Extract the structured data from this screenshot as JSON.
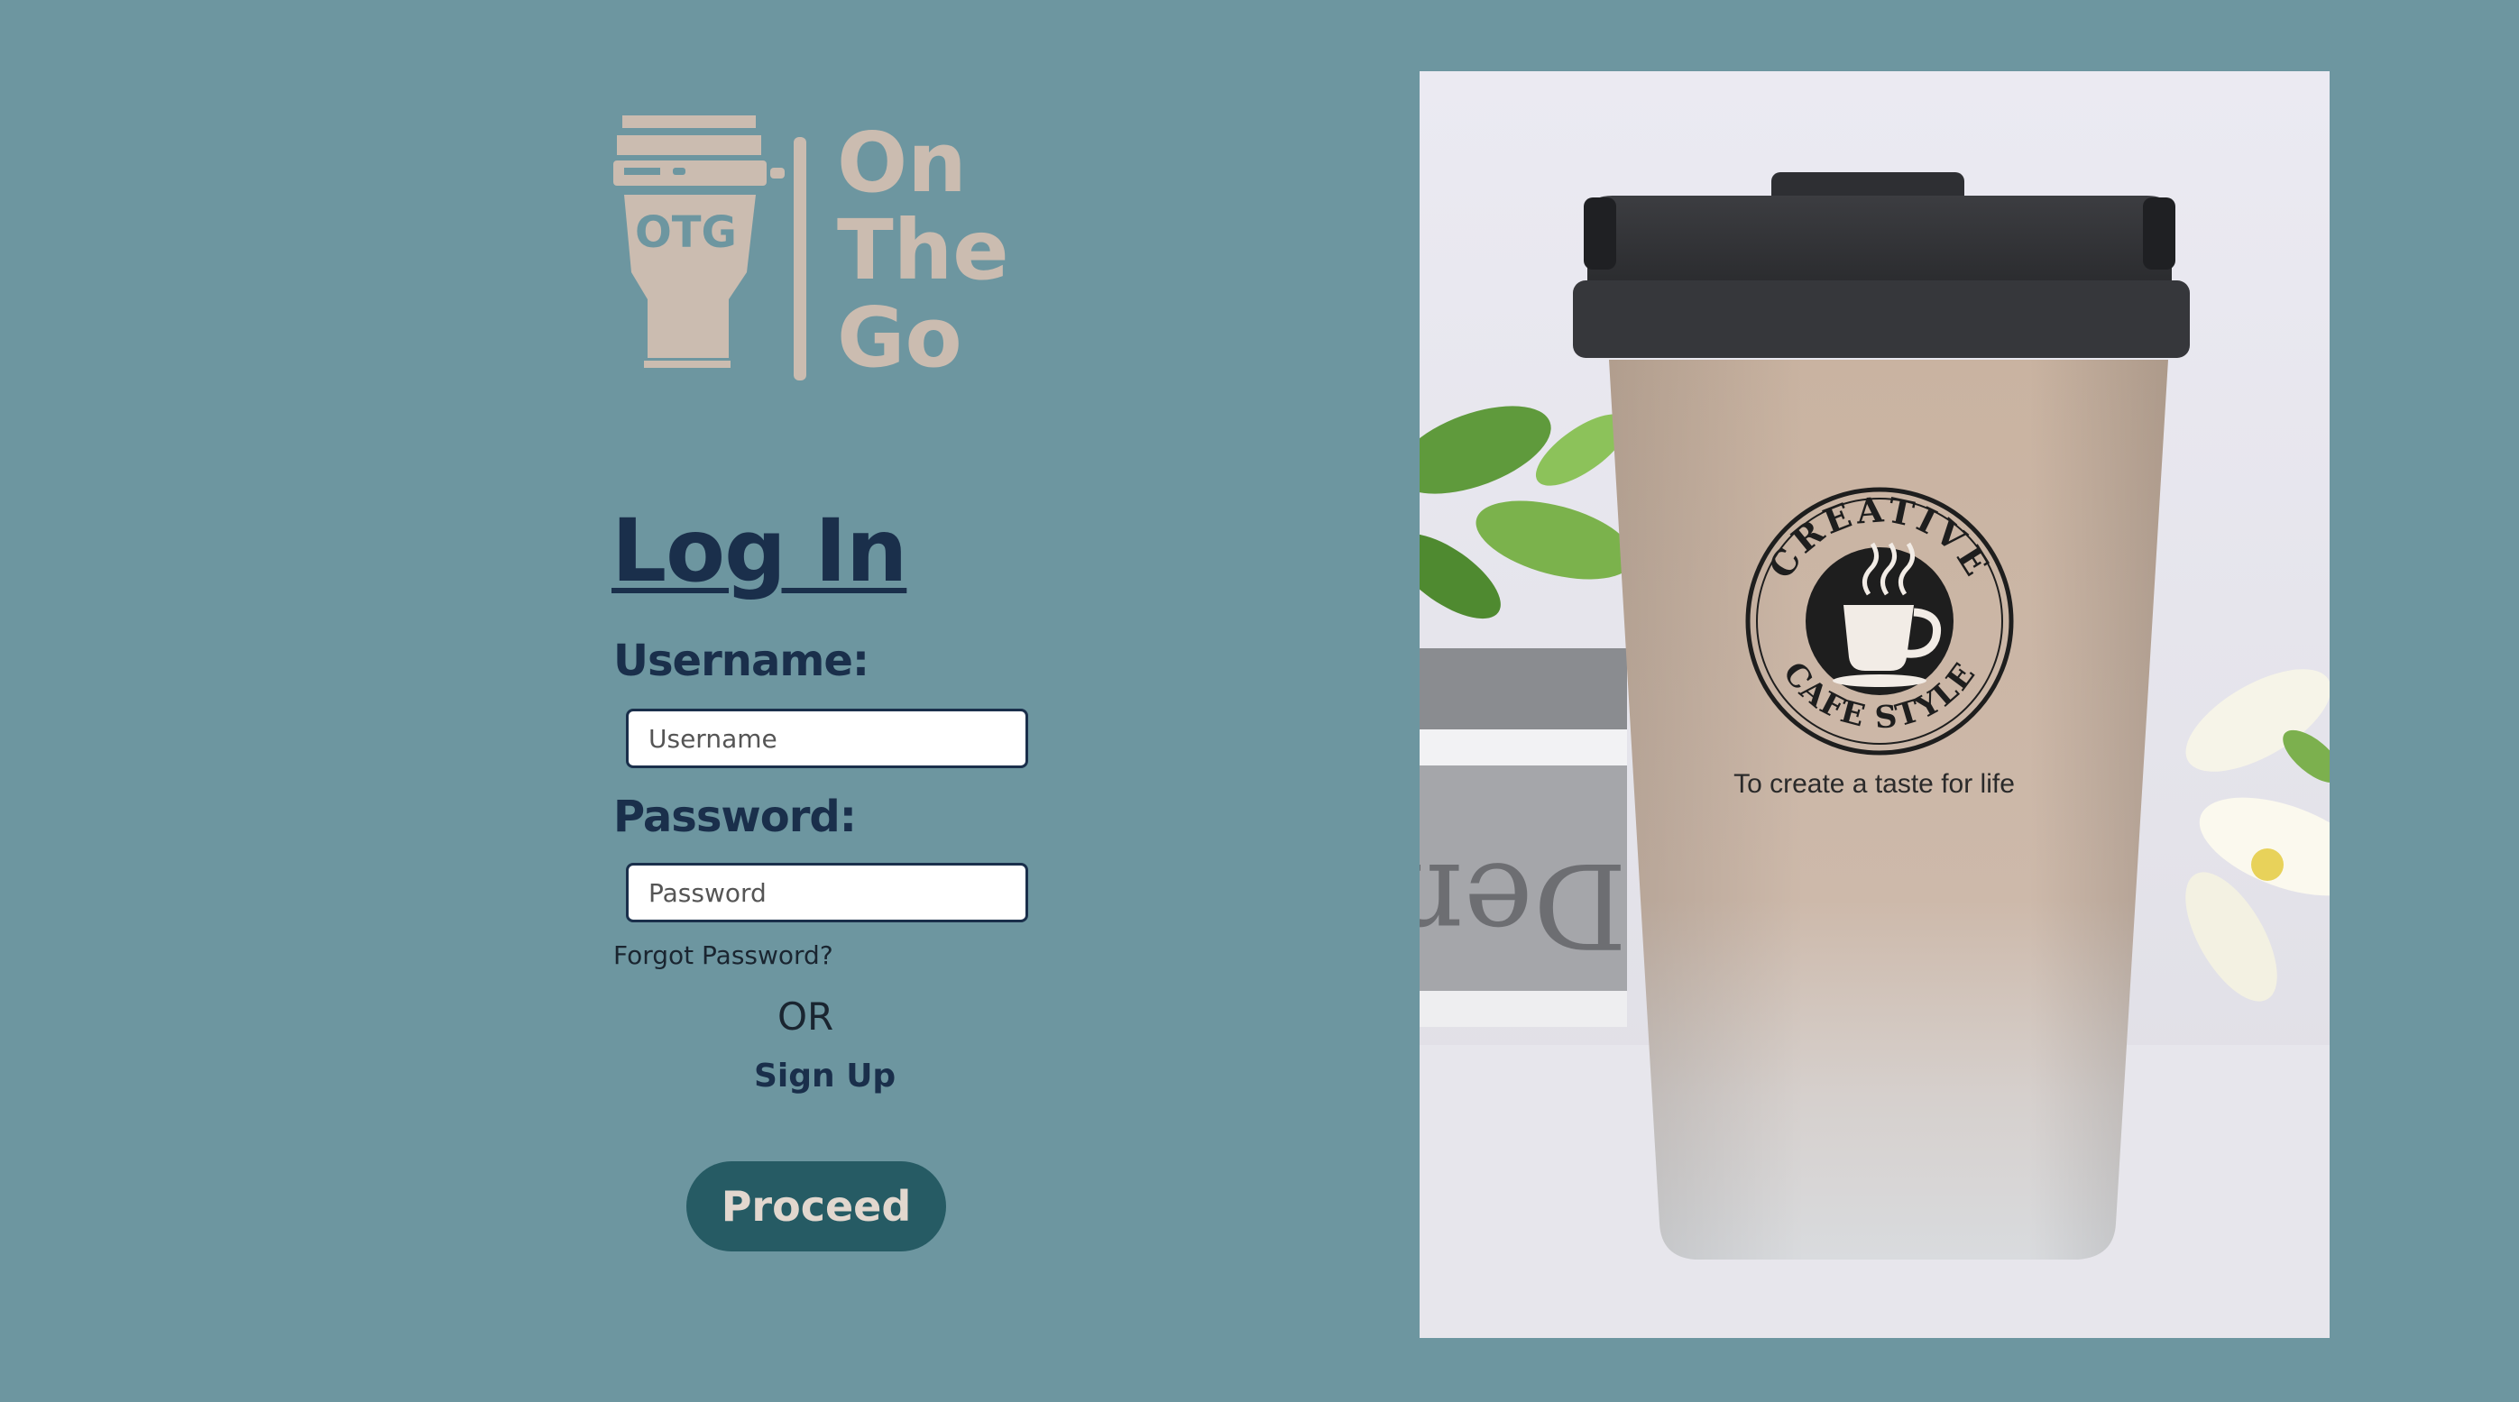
{
  "brand": {
    "logo_badge": "OTG",
    "logo_lines": [
      "On",
      "The",
      "Go"
    ]
  },
  "login": {
    "title": "Log In",
    "username_label": "Username:",
    "username_placeholder": "Username",
    "password_label": "Password:",
    "password_placeholder": "Password",
    "forgot_password": "Forgot Password?",
    "or_text": "OR",
    "signup_link": "Sign Up",
    "proceed_button": "Proceed"
  },
  "product_image": {
    "cup_emblem_top": "CREATIVE",
    "cup_emblem_bottom": "CAFE STYLE",
    "cup_tagline": "To create a taste for life",
    "book_spine_text": "Den"
  },
  "colors": {
    "background": "#6d96a0",
    "heading": "#1a2f4b",
    "logo": "#cbbcb0",
    "button": "#265b64"
  }
}
